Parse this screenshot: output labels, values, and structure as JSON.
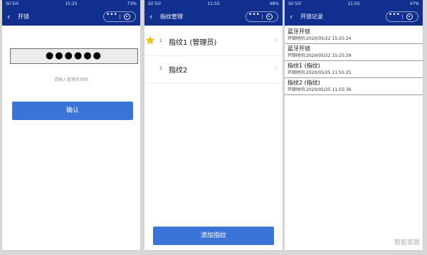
{
  "screens": [
    {
      "status": {
        "left": "Sil 5iil ",
        "time": "15:25",
        "right": "73%"
      },
      "nav": {
        "back_icon": "‹",
        "title": "开锁"
      },
      "password": {
        "value": "●●●●●●",
        "hint": "请输入管理员密码"
      },
      "confirm_label": "确认"
    },
    {
      "status": {
        "left": "Sil 5iil ",
        "time": "11:55",
        "right": "48%"
      },
      "nav": {
        "back_icon": "‹",
        "title": "指纹管理"
      },
      "fingerprints": [
        {
          "num": "1",
          "name": "指纹1 (管理员)",
          "starred": true
        },
        {
          "num": "2",
          "name": "指纹2",
          "starred": false
        }
      ],
      "add_label": "添加指纹"
    },
    {
      "status": {
        "left": "Sil 5iil ",
        "time": "11:55",
        "right": "47%"
      },
      "nav": {
        "back_icon": "‹",
        "title": "开锁记录"
      },
      "records": [
        {
          "title": "蓝牙开锁",
          "time": "开锁时间:2020/05/22 15:25:24"
        },
        {
          "title": "蓝牙开锁",
          "time": "开锁时间:2020/05/22 15:25:29"
        },
        {
          "title": "指纹1 (指纹)",
          "time": "开锁时间:2020/05/25 11:55:25"
        },
        {
          "title": "指纹2 (指纹)",
          "time": "开锁时间:2020/05/25 11:55:36"
        }
      ]
    }
  ],
  "capsule": {
    "more_icon": "•••"
  },
  "chevron": "›",
  "watermark": "智能家居",
  "colors": {
    "nav": "#102f8f",
    "button": "#3a74d8",
    "star": "#f7c51a"
  }
}
